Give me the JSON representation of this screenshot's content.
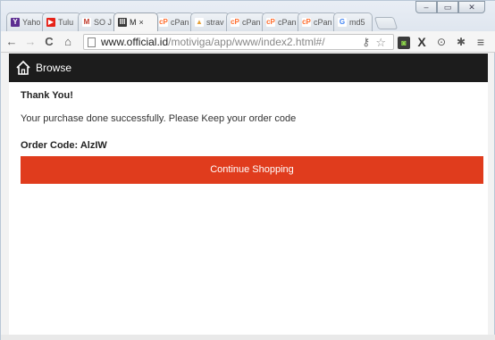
{
  "browser": {
    "tabs": [
      {
        "label": "Yaho",
        "favicon": "Y",
        "favicon_color": "#5c2d91",
        "favicon_fg": "#ffffff",
        "active": false
      },
      {
        "label": "Tulu",
        "favicon": "▶",
        "favicon_color": "#e62117",
        "favicon_fg": "#ffffff",
        "active": false
      },
      {
        "label": "SO J",
        "favicon": "M",
        "favicon_color": "#ffffff",
        "favicon_fg": "#c03a2b",
        "active": false
      },
      {
        "label": "M",
        "favicon": "III",
        "favicon_color": "#3a3a3a",
        "favicon_fg": "#ffffff",
        "active": true,
        "close": "×"
      },
      {
        "label": "cPan",
        "favicon": "cP",
        "favicon_color": "#ffffff",
        "favicon_fg": "#ff6c2c",
        "active": false
      },
      {
        "label": "strav",
        "favicon": "▲",
        "favicon_color": "#ffffff",
        "favicon_fg": "#e6a23c",
        "active": false
      },
      {
        "label": "cPan",
        "favicon": "cP",
        "favicon_color": "#ffffff",
        "favicon_fg": "#ff6c2c",
        "active": false
      },
      {
        "label": "cPan",
        "favicon": "cP",
        "favicon_color": "#ffffff",
        "favicon_fg": "#ff6c2c",
        "active": false
      },
      {
        "label": "cPan",
        "favicon": "cP",
        "favicon_color": "#ffffff",
        "favicon_fg": "#ff6c2c",
        "active": false
      },
      {
        "label": "md5",
        "favicon": "G",
        "favicon_color": "#ffffff",
        "favicon_fg": "#4285f4",
        "active": false
      }
    ],
    "window_controls": {
      "minimize": "‒",
      "maximize": "▭",
      "close": "✕"
    },
    "nav": {
      "back": "←",
      "forward": "→",
      "reload": "C",
      "home": "⌂"
    },
    "address": {
      "host": "www.official.id",
      "path": "/motiviga/app/www/index2.html#/"
    },
    "icons": {
      "key": "⚷",
      "star": "☆"
    },
    "extensions": [
      "◙",
      "X",
      "⊙",
      "✱",
      "≡"
    ]
  },
  "app": {
    "header": {
      "title": "Browse",
      "icon": "home-icon"
    },
    "thanks": "Thank You!",
    "message": "Your purchase done successfully. Please Keep your order code",
    "order_code": "Order Code: AlzIW",
    "continue_label": "Continue Shopping",
    "accent_color": "#e03c1d",
    "header_color": "#1c1c1c"
  }
}
